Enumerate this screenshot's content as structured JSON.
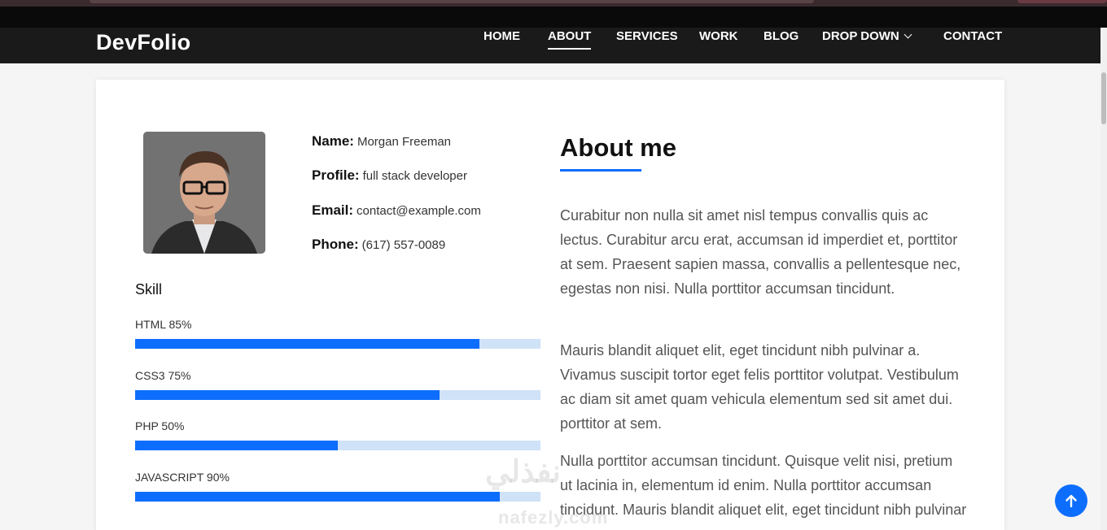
{
  "brand": "DevFolio",
  "nav": [
    {
      "label": "HOME",
      "active": false
    },
    {
      "label": "ABOUT",
      "active": true
    },
    {
      "label": "SERVICES",
      "active": false
    },
    {
      "label": "WORK",
      "active": false
    },
    {
      "label": "BLOG",
      "active": false
    },
    {
      "label": "DROP DOWN",
      "active": false
    },
    {
      "label": "CONTACT",
      "active": false
    }
  ],
  "profile": {
    "name_label": "Name:",
    "name": "Morgan Freeman",
    "profile_label": "Profile:",
    "profile": "full stack developer",
    "email_label": "Email:",
    "email": "contact@example.com",
    "phone_label": "Phone:",
    "phone": "(617) 557-0089"
  },
  "skills": {
    "title": "Skill",
    "items": [
      {
        "label": "HTML 85%",
        "percent": 85
      },
      {
        "label": "CSS3 75%",
        "percent": 75
      },
      {
        "label": "PHP 50%",
        "percent": 50
      },
      {
        "label": "JAVASCRIPT 90%",
        "percent": 90
      }
    ]
  },
  "about": {
    "title": "About me",
    "paragraphs": [
      "Curabitur non nulla sit amet nisl tempus convallis quis ac lectus. Curabitur arcu erat, accumsan id imperdiet et, porttitor at sem. Praesent sapien massa, convallis a pellentesque nec, egestas non nisi. Nulla porttitor accumsan tincidunt.",
      "Mauris blandit aliquet elit, eget tincidunt nibh pulvinar a. Vivamus suscipit tortor eget felis porttitor volutpat. Vestibulum ac diam sit amet quam vehicula elementum sed sit amet dui. porttitor at sem.",
      "Nulla porttitor accumsan tincidunt. Quisque velit nisi, pretium ut lacinia in, elementum id enim. Nulla porttitor accumsan tincidunt. Mauris blandit aliquet elit, eget tincidunt nibh pulvinar a."
    ]
  },
  "watermark": {
    "arabic": "نفذلي",
    "latin": "nafezly.com"
  },
  "colors": {
    "accent": "#0d6efd",
    "navbar": "#1a1a1a",
    "track": "#cfe2f7"
  },
  "icons": {
    "back_to_top": "arrow-up-icon",
    "dropdown": "chevron-down-icon"
  }
}
